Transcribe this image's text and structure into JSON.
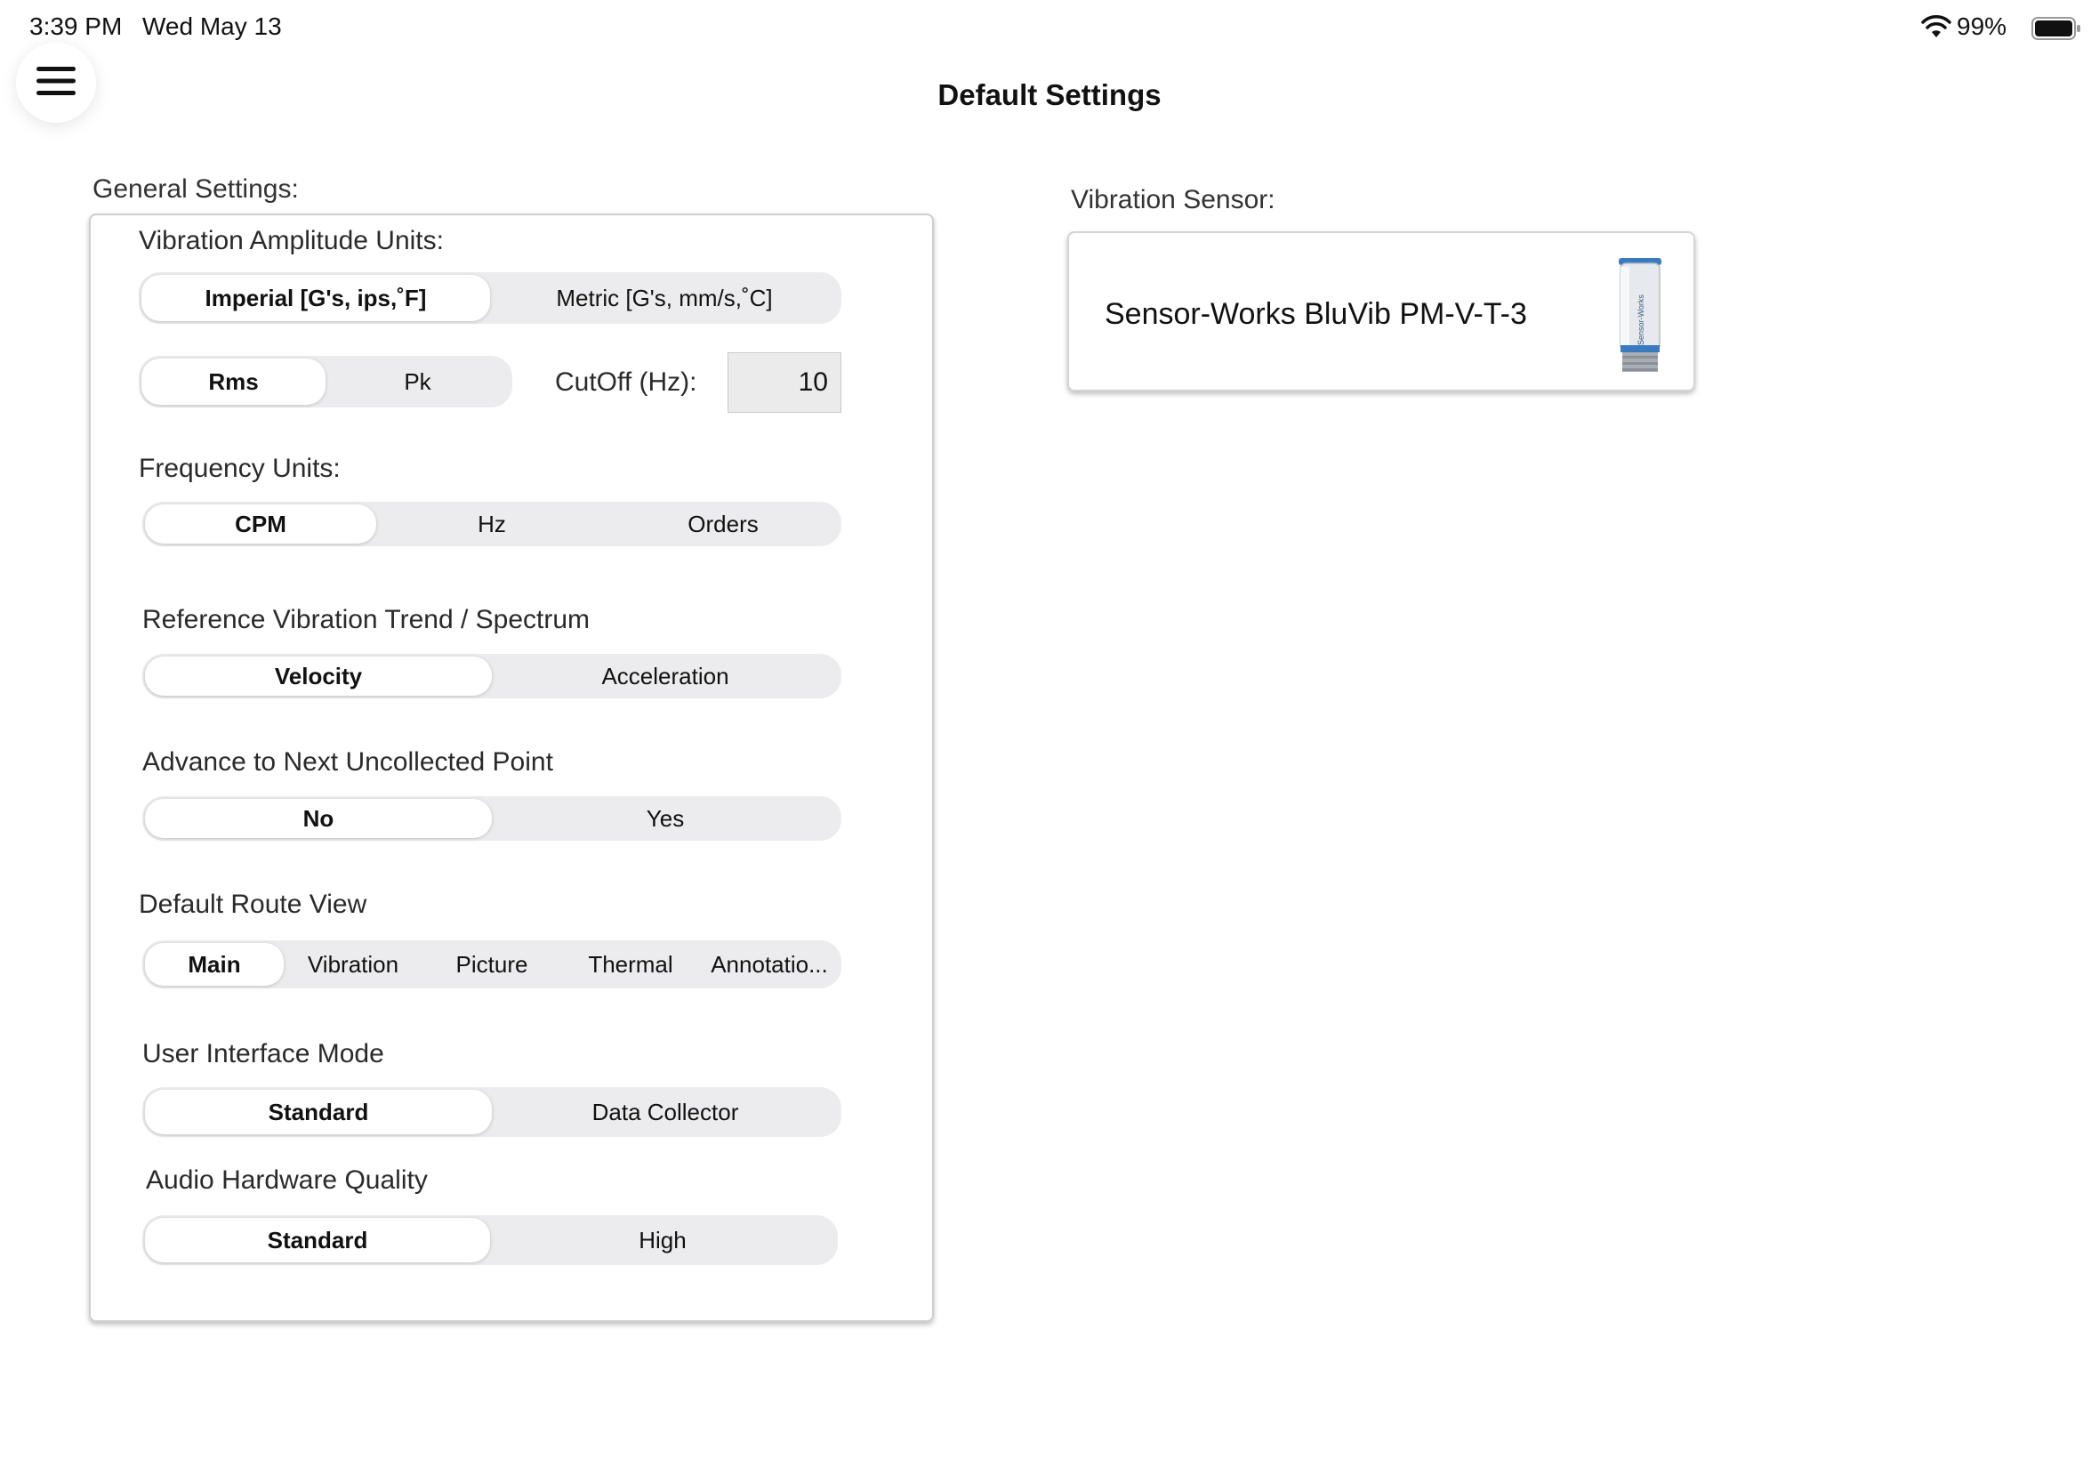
{
  "status_bar": {
    "time": "3:39 PM",
    "date": "Wed May 13",
    "battery": "99%"
  },
  "header": {
    "title": "Default Settings"
  },
  "general": {
    "label": "General Settings:",
    "amplitude_units": {
      "label": "Vibration Amplitude Units:",
      "options": [
        "Imperial [G's, ips,˚F]",
        "Metric [G's, mm/s,˚C]"
      ],
      "selected": "Imperial [G's, ips,˚F]"
    },
    "detection": {
      "options": [
        "Rms",
        "Pk"
      ],
      "selected": "Rms"
    },
    "cutoff": {
      "label": "CutOff (Hz):",
      "value": "10"
    },
    "frequency_units": {
      "label": "Frequency Units:",
      "options": [
        "CPM",
        "Hz",
        "Orders"
      ],
      "selected": "CPM"
    },
    "reference_trend": {
      "label": "Reference Vibration Trend / Spectrum",
      "options": [
        "Velocity",
        "Acceleration"
      ],
      "selected": "Velocity"
    },
    "advance_next": {
      "label": "Advance to Next Uncollected Point",
      "options": [
        "No",
        "Yes"
      ],
      "selected": "No"
    },
    "route_view": {
      "label": "Default Route View",
      "options": [
        "Main",
        "Vibration",
        "Picture",
        "Thermal",
        "Annotatio..."
      ],
      "selected": "Main"
    },
    "ui_mode": {
      "label": "User Interface Mode",
      "options": [
        "Standard",
        "Data Collector"
      ],
      "selected": "Standard"
    },
    "audio_quality": {
      "label": "Audio Hardware Quality",
      "options": [
        "Standard",
        "High"
      ],
      "selected": "Standard"
    }
  },
  "sensor": {
    "label": "Vibration Sensor:",
    "name": "Sensor-Works BluVib PM-V-T-3",
    "image_text": "Sensor-Works"
  },
  "colors": {
    "segment_bg": "#ececee",
    "sensor_blue": "#3a7bbf"
  }
}
